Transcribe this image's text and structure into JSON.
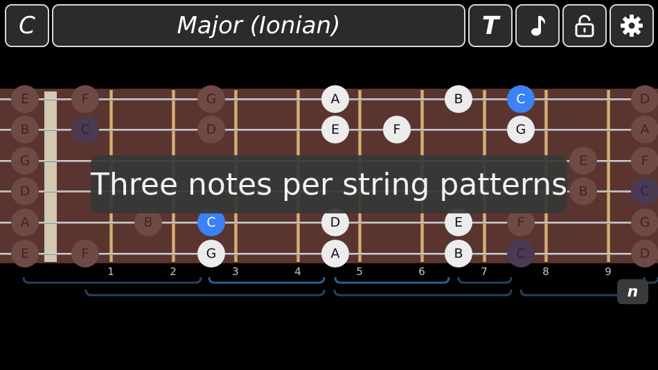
{
  "topbar": {
    "key": "C",
    "scale": "Major (Ionian)",
    "text_toggle": "T",
    "icons": [
      "music-note-icon",
      "lock-icon",
      "gear-icon"
    ]
  },
  "fret_numbers": [
    "1",
    "2",
    "3",
    "4",
    "5",
    "6",
    "7",
    "8",
    "9"
  ],
  "overlay_text": "Three notes per string patterns",
  "pattern_button": "n",
  "colors": {
    "root": "#3b82f5",
    "note": "#ececec",
    "wood": "#5a3530",
    "bracket": "#2f5b9a"
  },
  "strings": [
    {
      "open": "E",
      "notes": [
        {
          "label": "F",
          "state": "dim",
          "fret": 1
        },
        {
          "label": "G",
          "state": "dim",
          "fret": 3
        },
        {
          "label": "A",
          "state": "on",
          "fret": 5
        },
        {
          "label": "B",
          "state": "on",
          "fret": 7
        },
        {
          "label": "C",
          "state": "root",
          "fret": 8
        },
        {
          "label": "D",
          "state": "dim",
          "fret": 10
        }
      ]
    },
    {
      "open": "B",
      "notes": [
        {
          "label": "C",
          "state": "dimroot",
          "fret": 1
        },
        {
          "label": "D",
          "state": "dim",
          "fret": 3
        },
        {
          "label": "E",
          "state": "on",
          "fret": 5
        },
        {
          "label": "F",
          "state": "on",
          "fret": 6
        },
        {
          "label": "G",
          "state": "on",
          "fret": 8
        },
        {
          "label": "A",
          "state": "dim",
          "fret": 10
        }
      ]
    },
    {
      "open": "G",
      "notes": [
        {
          "label": "E",
          "state": "dim",
          "fret": 9
        },
        {
          "label": "F",
          "state": "dim",
          "fret": 10
        }
      ]
    },
    {
      "open": "D",
      "notes": [
        {
          "label": "B",
          "state": "dim",
          "fret": 9
        },
        {
          "label": "C",
          "state": "dimroot",
          "fret": 10
        }
      ]
    },
    {
      "open": "A",
      "notes": [
        {
          "label": "B",
          "state": "dim",
          "fret": 2
        },
        {
          "label": "C",
          "state": "root",
          "fret": 3
        },
        {
          "label": "D",
          "state": "on",
          "fret": 5
        },
        {
          "label": "E",
          "state": "on",
          "fret": 7
        },
        {
          "label": "F",
          "state": "dim",
          "fret": 8
        },
        {
          "label": "G",
          "state": "dim",
          "fret": 10
        }
      ]
    },
    {
      "open": "E",
      "notes": [
        {
          "label": "F",
          "state": "dim",
          "fret": 1
        },
        {
          "label": "G",
          "state": "on",
          "fret": 3
        },
        {
          "label": "A",
          "state": "on",
          "fret": 5
        },
        {
          "label": "B",
          "state": "on",
          "fret": 7
        },
        {
          "label": "C",
          "state": "dimroot",
          "fret": 8
        },
        {
          "label": "D",
          "state": "dim",
          "fret": 10
        }
      ]
    }
  ]
}
